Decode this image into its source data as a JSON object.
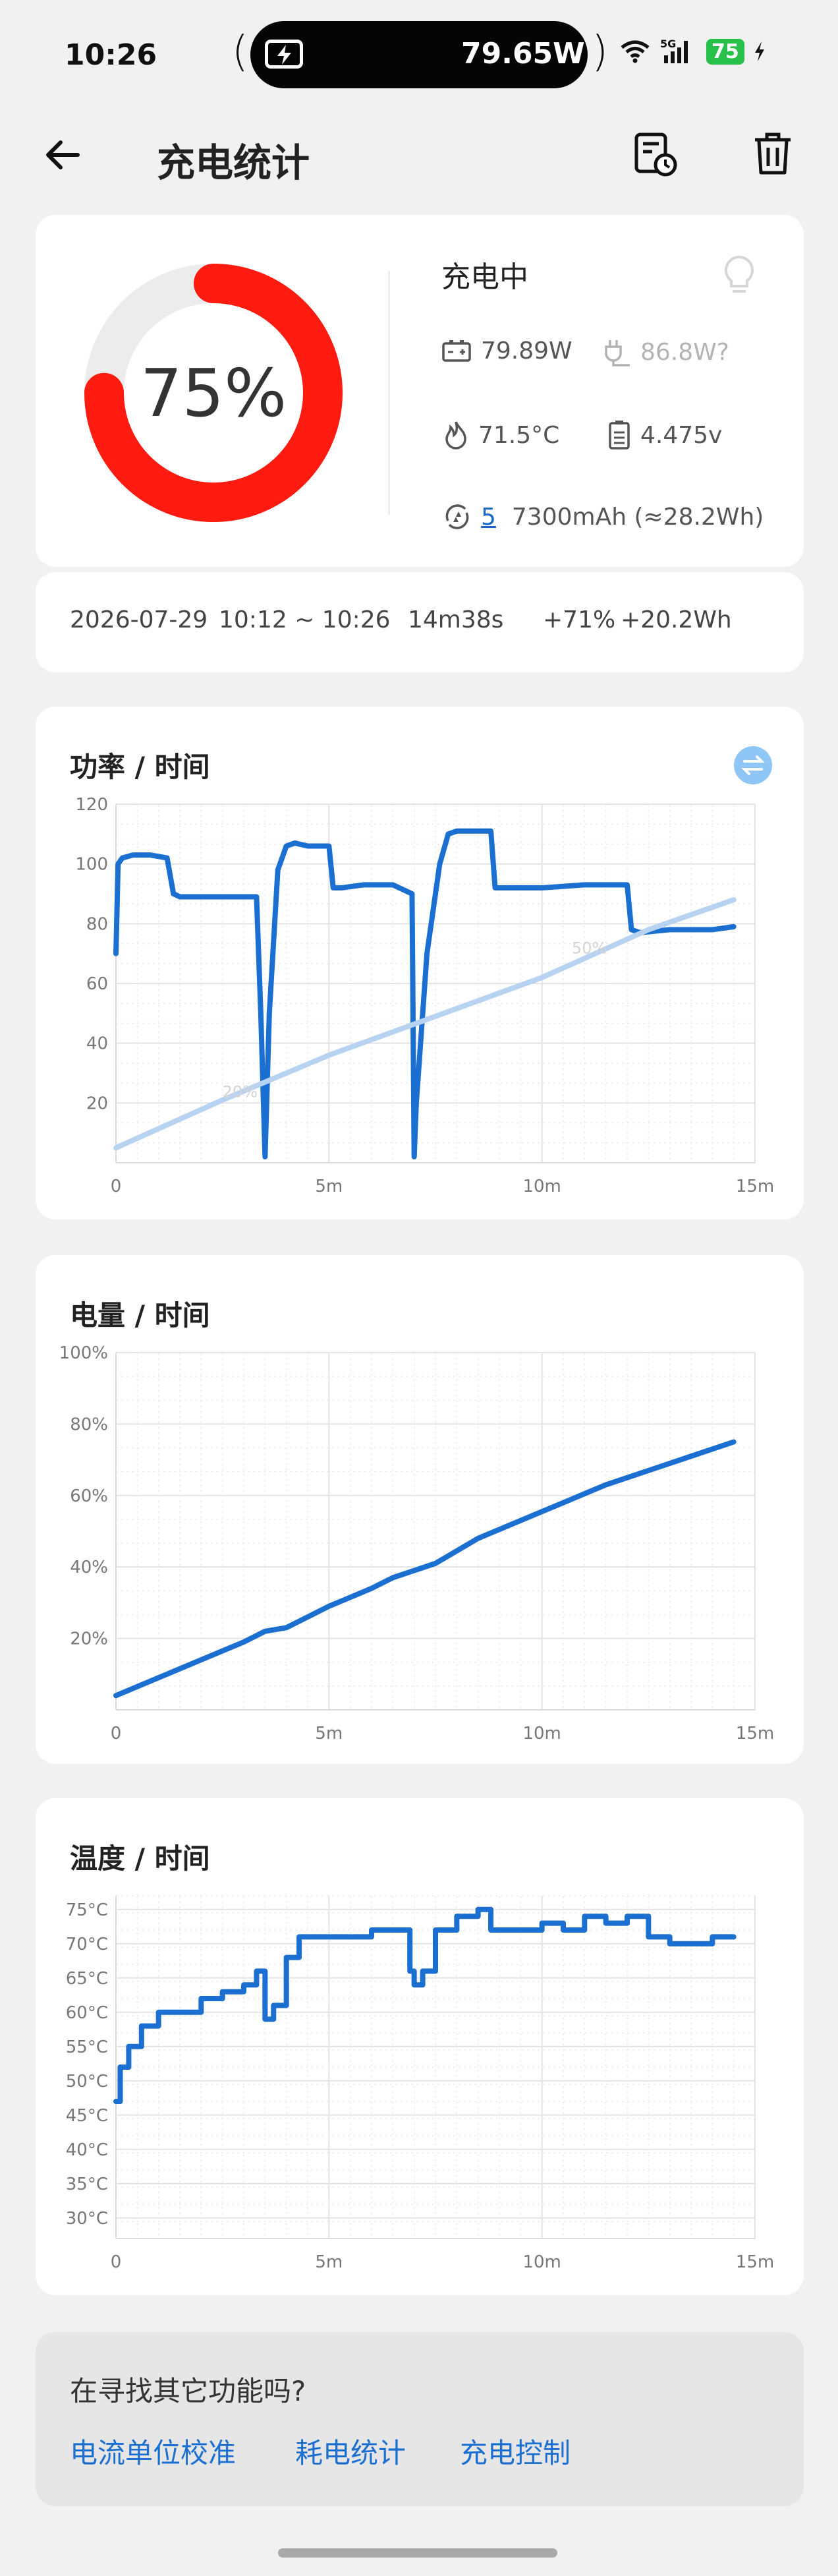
{
  "status_bar": {
    "time": "10:26",
    "power": "79.65W",
    "network": "5G",
    "battery": "75"
  },
  "header": {
    "title": "充电统计"
  },
  "summary": {
    "percent_label": "75%",
    "percent_value": 75,
    "status": "充电中",
    "power": "79.89W",
    "max_power": "86.8W?",
    "temperature": "71.5°C",
    "voltage": "4.475v",
    "cycle_count": "5",
    "capacity": "7300mAh (≈28.2Wh)"
  },
  "session": {
    "date": "2026-07-29",
    "time_range": "10:12 ~ 10:26",
    "duration": "14m38s",
    "percent_gain": "+71%",
    "energy_gain": "+20.2Wh"
  },
  "power_chart": {
    "title": "功率 / 时间"
  },
  "battery_chart": {
    "title": "电量 / 时间"
  },
  "temp_chart": {
    "title": "温度 / 时间"
  },
  "chart_data": [
    {
      "type": "line",
      "title": "功率 / 时间",
      "x_ticks": [
        "0",
        "5m",
        "10m",
        "15m"
      ],
      "y_ticks": [
        "20",
        "40",
        "60",
        "80",
        "100",
        "120"
      ],
      "xlim": [
        0,
        15
      ],
      "ylim": [
        0,
        120
      ],
      "annotations": [
        "20%",
        "50%"
      ],
      "series": [
        {
          "x": [
            0,
            0.05,
            0.15,
            0.4,
            0.8,
            1.2,
            1.35,
            1.5,
            2.0,
            2.5,
            3.0,
            3.3,
            3.4,
            3.5,
            3.6,
            3.8,
            4.0,
            4.2,
            4.5,
            5.0,
            5.1,
            5.3,
            5.8,
            6.5,
            6.95,
            7.0,
            7.05,
            7.3,
            7.6,
            7.8,
            8.0,
            8.5,
            8.8,
            8.9,
            9.2,
            10.0,
            11.0,
            12.0,
            12.1,
            12.3,
            13.0,
            14.0,
            14.5
          ],
          "y": [
            70,
            100,
            102,
            103,
            103,
            102,
            90,
            89,
            89,
            89,
            89,
            89,
            50,
            2,
            50,
            98,
            106,
            107,
            106,
            106,
            92,
            92,
            93,
            93,
            90,
            2,
            20,
            70,
            100,
            110,
            111,
            111,
            111,
            92,
            92,
            92,
            93,
            93,
            78,
            77,
            78,
            78,
            79
          ]
        },
        {
          "x": [
            0,
            2.5,
            5,
            7.5,
            10,
            12.5,
            14.5
          ],
          "y": [
            5,
            21,
            36,
            49,
            62,
            78,
            88
          ]
        }
      ]
    },
    {
      "type": "line",
      "title": "电量 / 时间",
      "x_ticks": [
        "0",
        "5m",
        "10m",
        "15m"
      ],
      "y_ticks": [
        "20%",
        "40%",
        "60%",
        "80%",
        "100%"
      ],
      "xlim": [
        0,
        15
      ],
      "ylim": [
        0,
        100
      ],
      "series": [
        {
          "x": [
            0,
            1,
            2,
            3,
            3.5,
            4,
            5,
            6,
            6.5,
            7.5,
            8.5,
            9.5,
            10.5,
            11.5,
            12.5,
            13.5,
            14.5
          ],
          "y": [
            4,
            9,
            14,
            19,
            22,
            23,
            29,
            34,
            37,
            41,
            48,
            53,
            58,
            63,
            67,
            71,
            75
          ]
        }
      ]
    },
    {
      "type": "line",
      "title": "温度 / 时间",
      "x_ticks": [
        "0",
        "5m",
        "10m",
        "15m"
      ],
      "y_ticks": [
        "30°C",
        "35°C",
        "40°C",
        "45°C",
        "50°C",
        "55°C",
        "60°C",
        "65°C",
        "70°C",
        "75°C"
      ],
      "xlim": [
        0,
        15
      ],
      "ylim": [
        27,
        77
      ],
      "series": [
        {
          "x": [
            0,
            0.1,
            0.3,
            0.6,
            1.0,
            1.5,
            2.0,
            2.5,
            3.0,
            3.3,
            3.5,
            3.7,
            4.0,
            4.3,
            4.6,
            5.0,
            5.5,
            6.0,
            6.5,
            6.9,
            7.0,
            7.2,
            7.5,
            8.0,
            8.5,
            8.8,
            9.2,
            10.0,
            10.5,
            11.0,
            11.5,
            12.0,
            12.5,
            13.0,
            13.5,
            14.0,
            14.5
          ],
          "y": [
            47,
            52,
            55,
            58,
            60,
            60,
            62,
            63,
            64,
            66,
            59,
            61,
            68,
            71,
            71,
            71,
            71,
            72,
            72,
            66,
            64,
            66,
            72,
            74,
            75,
            72,
            72,
            73,
            72,
            74,
            73,
            74,
            71,
            70,
            70,
            71,
            71
          ]
        }
      ]
    }
  ],
  "find_more": {
    "title": "在寻找其它功能吗?",
    "links": [
      "电流单位校准",
      "耗电统计",
      "充电控制"
    ]
  },
  "colors": {
    "accent": "#1a6fd1",
    "ring": "#ff1b0f",
    "line": "#1a6fd1",
    "soft_line": "#b8d2f2",
    "battery_green": "#27c04a"
  }
}
